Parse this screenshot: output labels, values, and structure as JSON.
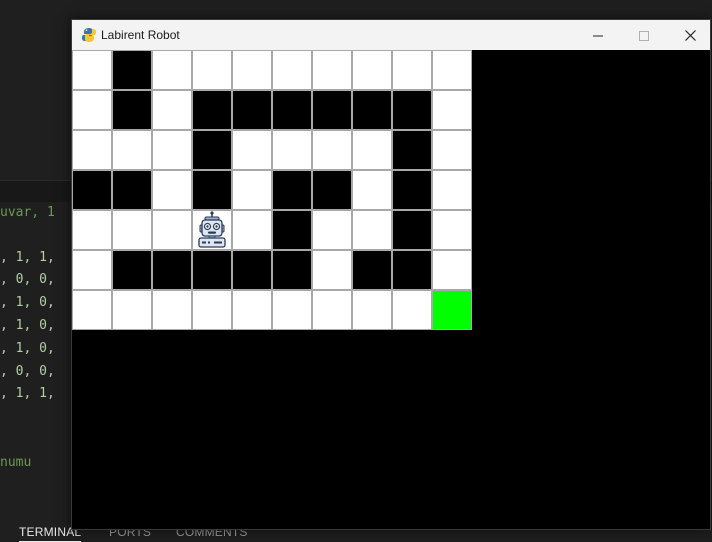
{
  "editor": {
    "code_top": "uvar, 1",
    "code_rows": [
      ", 1, 1,",
      ", 0, 0,",
      ", 1, 0,",
      ", 1, 0,",
      ", 1, 0,",
      ", 0, 0,",
      ", 1, 1,"
    ],
    "code_bottom": "numu",
    "panel_tabs": [
      "TERMINAL",
      "PORTS",
      "COMMENTS"
    ]
  },
  "window": {
    "title": "Labirent Robot",
    "controls": {
      "minimize": "minimize-icon",
      "maximize": "maximize-icon",
      "close": "close-icon"
    }
  },
  "maze": {
    "rows": 7,
    "cols": 10,
    "grid": [
      [
        0,
        1,
        0,
        0,
        0,
        0,
        0,
        0,
        0,
        0
      ],
      [
        0,
        1,
        0,
        1,
        1,
        1,
        1,
        1,
        1,
        0
      ],
      [
        0,
        0,
        0,
        1,
        0,
        0,
        0,
        0,
        1,
        0
      ],
      [
        1,
        1,
        0,
        1,
        0,
        1,
        1,
        0,
        1,
        0
      ],
      [
        0,
        0,
        0,
        0,
        0,
        1,
        0,
        0,
        1,
        0
      ],
      [
        0,
        1,
        1,
        1,
        1,
        1,
        0,
        1,
        1,
        0
      ],
      [
        0,
        0,
        0,
        0,
        0,
        0,
        0,
        0,
        0,
        0
      ]
    ],
    "robot": {
      "row": 4,
      "col": 3
    },
    "goal": {
      "row": 6,
      "col": 9
    },
    "colors": {
      "open": "#ffffff",
      "wall": "#000000",
      "goal": "#00ff00",
      "grid_line": "#a8a8a8"
    }
  }
}
